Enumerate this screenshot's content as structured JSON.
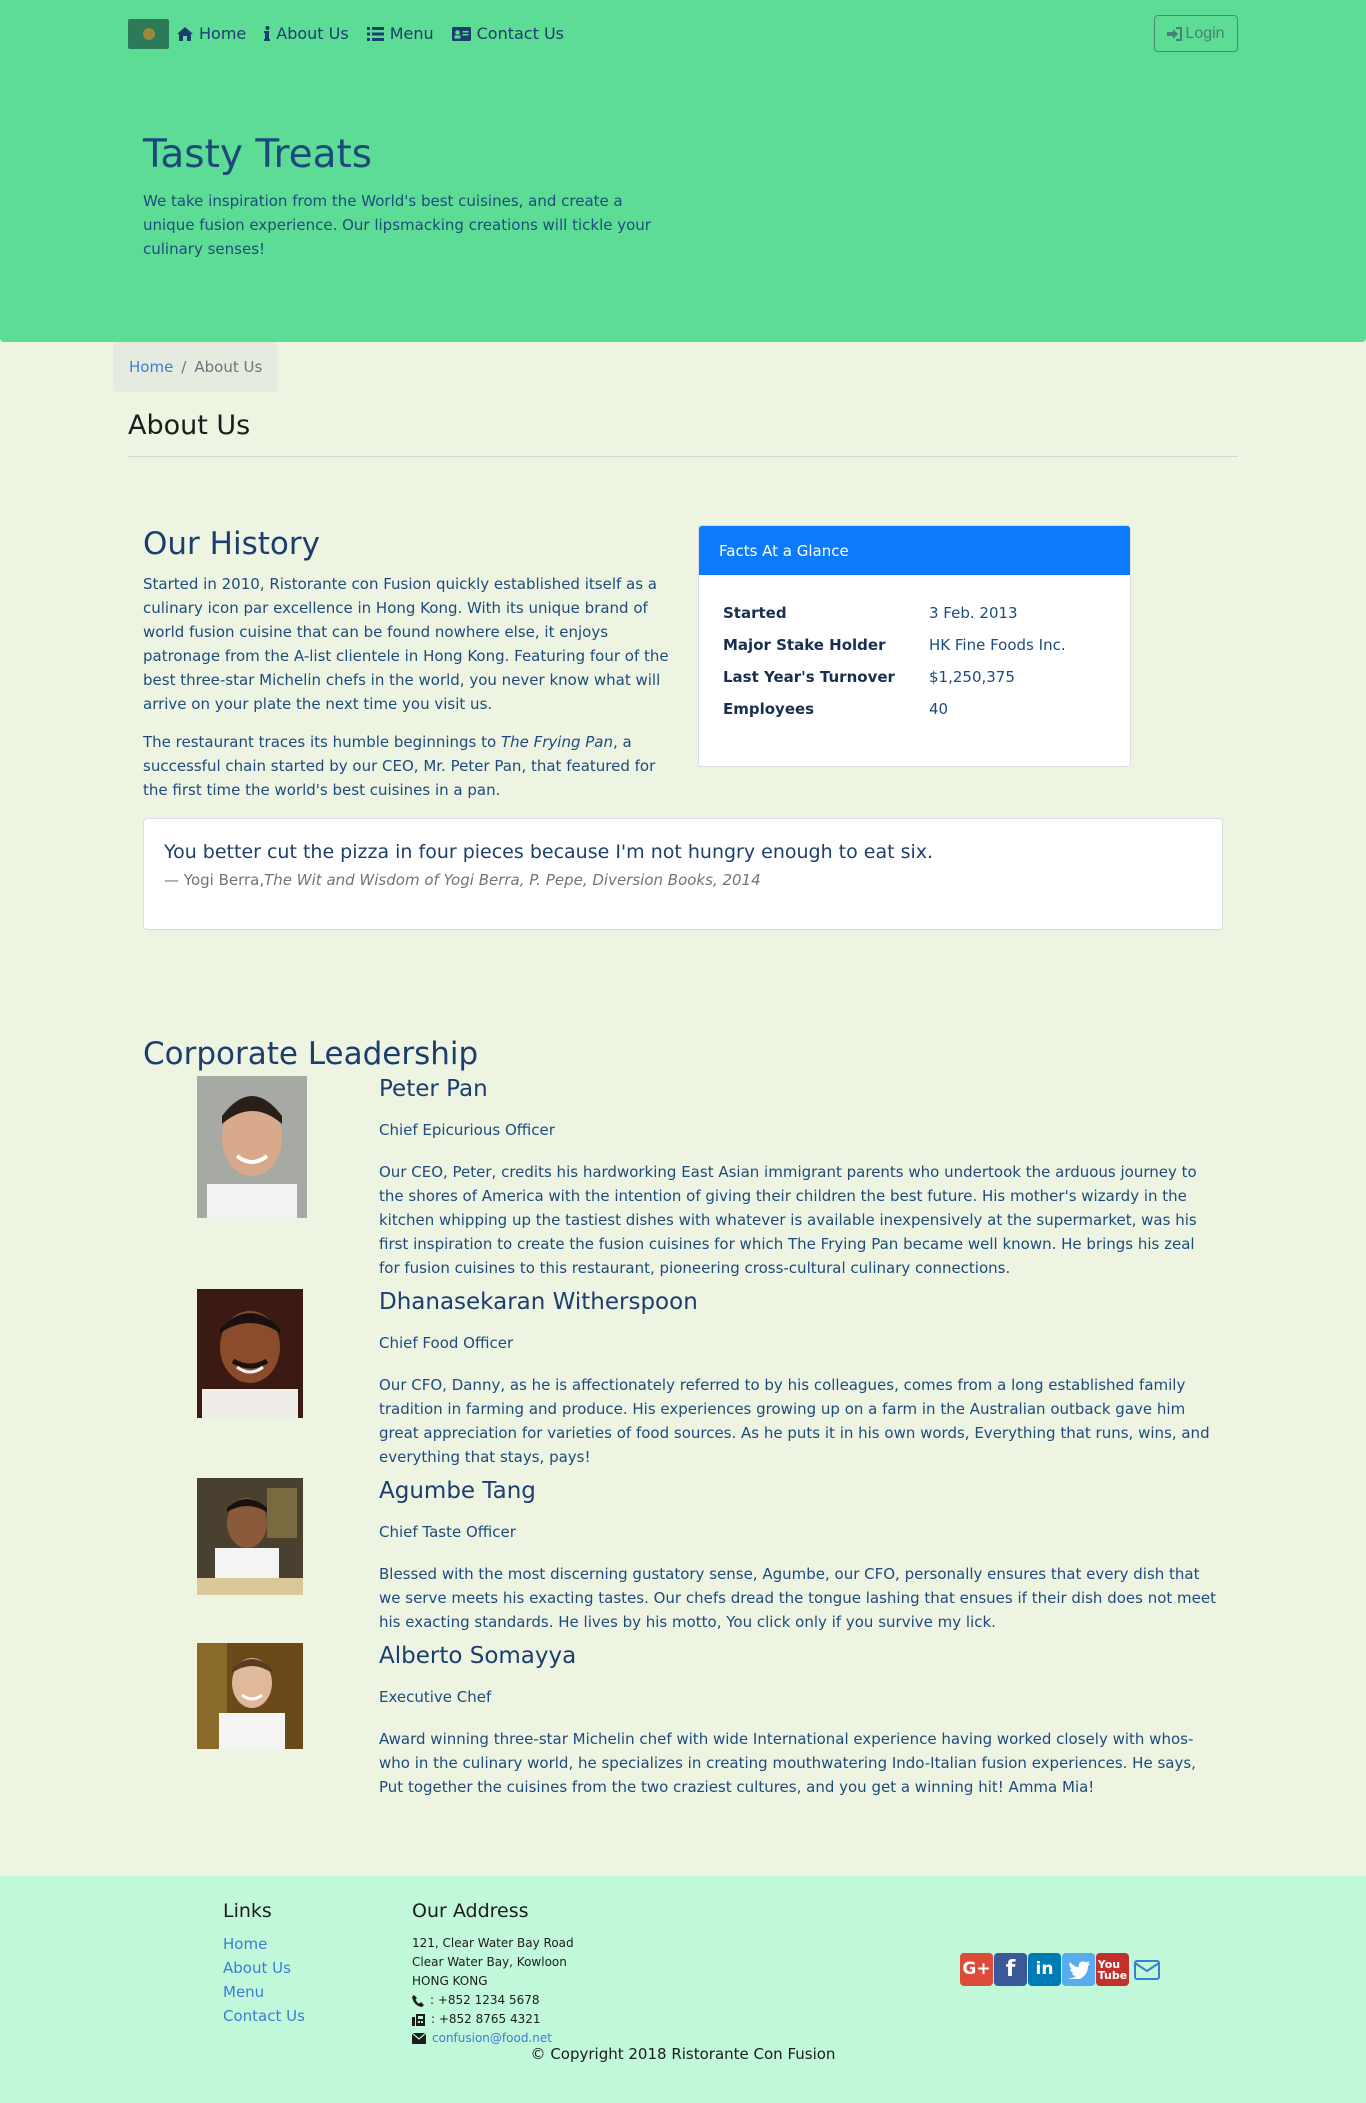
{
  "nav": {
    "items": [
      {
        "label": "Home",
        "icon": "home-icon"
      },
      {
        "label": "About Us",
        "icon": "info-icon"
      },
      {
        "label": "Menu",
        "icon": "list-icon"
      },
      {
        "label": "Contact Us",
        "icon": "address-card-icon"
      }
    ],
    "login_label": "Login"
  },
  "jumbotron": {
    "title": "Tasty Treats",
    "text": "We take inspiration from the World's best cuisines, and create a unique fusion experience. Our lipsmacking creations will tickle your culinary senses!"
  },
  "breadcrumb": {
    "home": "Home",
    "sep": "/",
    "active": "About Us"
  },
  "page_title": "About Us",
  "history": {
    "title": "Our History",
    "p1": "Started in 2010, Ristorante con Fusion quickly established itself as a culinary icon par excellence in Hong Kong. With its unique brand of world fusion cuisine that can be found nowhere else, it enjoys patronage from the A-list clientele in Hong Kong. Featuring four of the best three-star Michelin chefs in the world, you never know what will arrive on your plate the next time you visit us.",
    "p2_before": "The restaurant traces its humble beginnings to ",
    "p2_em": "The Frying Pan",
    "p2_after": ", a successful chain started by our CEO, Mr. Peter Pan, that featured for the first time the world's best cuisines in a pan."
  },
  "facts": {
    "header": "Facts At a Glance",
    "rows": [
      {
        "key": "Started",
        "value": "3 Feb. 2013"
      },
      {
        "key": "Major Stake Holder",
        "value": "HK Fine Foods Inc."
      },
      {
        "key": "Last Year's Turnover",
        "value": "$1,250,375"
      },
      {
        "key": "Employees",
        "value": "40"
      }
    ]
  },
  "quote": {
    "text": "You better cut the pizza in four pieces because I'm not hungry enough to eat six.",
    "author": "— Yogi Berra,",
    "source": "The Wit and Wisdom of Yogi Berra, P. Pepe, Diversion Books, 2014"
  },
  "leadership": {
    "title": "Corporate Leadership",
    "leaders": [
      {
        "name": "Peter Pan",
        "role": "Chief Epicurious Officer",
        "desc": "Our CEO, Peter, credits his hardworking East Asian immigrant parents who undertook the arduous journey to the shores of America with the intention of giving their children the best future. His mother's wizardy in the kitchen whipping up the tastiest dishes with whatever is available inexpensively at the supermarket, was his first inspiration to create the fusion cuisines for which The Frying Pan became well known. He brings his zeal for fusion cuisines to this restaurant, pioneering cross-cultural culinary connections."
      },
      {
        "name": "Dhanasekaran Witherspoon",
        "role": "Chief Food Officer",
        "desc": "Our CFO, Danny, as he is affectionately referred to by his colleagues, comes from a long established family tradition in farming and produce. His experiences growing up on a farm in the Australian outback gave him great appreciation for varieties of food sources. As he puts it in his own words, Everything that runs, wins, and everything that stays, pays!"
      },
      {
        "name": "Agumbe Tang",
        "role": "Chief Taste Officer",
        "desc": "Blessed with the most discerning gustatory sense, Agumbe, our CFO, personally ensures that every dish that we serve meets his exacting tastes. Our chefs dread the tongue lashing that ensues if their dish does not meet his exacting standards. He lives by his motto, You click only if you survive my lick."
      },
      {
        "name": "Alberto Somayya",
        "role": "Executive Chef",
        "desc": "Award winning three-star Michelin chef with wide International experience having worked closely with whos-who in the culinary world, he specializes in creating mouthwatering Indo-Italian fusion experiences. He says, Put together the cuisines from the two craziest cultures, and you get a winning hit! Amma Mia!"
      }
    ]
  },
  "footer": {
    "links_title": "Links",
    "links": [
      "Home",
      "About Us",
      "Menu",
      "Contact Us"
    ],
    "address_title": "Our Address",
    "address": [
      "121, Clear Water Bay Road",
      "Clear Water Bay, Kowloon",
      "HONG KONG"
    ],
    "phone": ": +852 1234 5678",
    "fax": ": +852 8765 4321",
    "email": "confusion@food.net",
    "social": [
      "google-plus-icon",
      "facebook-icon",
      "linkedin-icon",
      "twitter-icon",
      "youtube-icon",
      "envelope-icon"
    ],
    "copyright": "© Copyright 2018 Ristorante Con Fusion"
  },
  "colors": {
    "header_bg": "#5cdc94",
    "body_bg": "#edf4e2",
    "footer_bg": "#c1f8d9",
    "card_header": "#0b7bfb",
    "link": "#3c7dd4"
  }
}
